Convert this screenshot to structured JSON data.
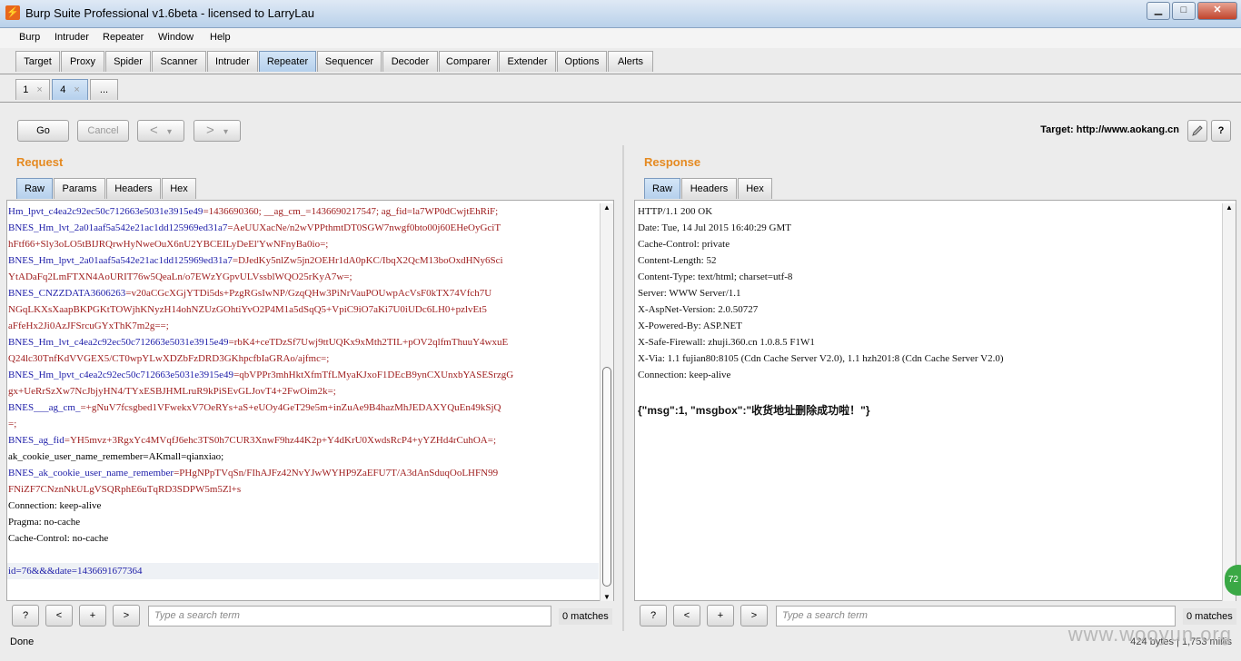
{
  "window": {
    "title": "Burp Suite Professional v1.6beta - licensed to LarryLau",
    "app_icon": "burp-icon",
    "minimize": "▁",
    "maximize": "□",
    "close": "✕"
  },
  "menu": [
    "Burp",
    "Intruder",
    "Repeater",
    "Window",
    "Help"
  ],
  "tabs": [
    "Target",
    "Proxy",
    "Spider",
    "Scanner",
    "Intruder",
    "Repeater",
    "Sequencer",
    "Decoder",
    "Comparer",
    "Extender",
    "Options",
    "Alerts"
  ],
  "active_tab": "Repeater",
  "repeater_tabs": [
    {
      "label": "1",
      "close": "×"
    },
    {
      "label": "4",
      "close": "×"
    },
    {
      "label": "..."
    }
  ],
  "toolbar": {
    "go": "Go",
    "cancel": "Cancel",
    "back": "<",
    "back_menu": "▾",
    "forward": ">",
    "forward_menu": "▾",
    "target": "Target: http://www.aokang.cn",
    "edit_icon": "pencil-icon",
    "help": "?"
  },
  "request": {
    "title": "Request",
    "tabs": [
      "Raw",
      "Params",
      "Headers",
      "Hex"
    ],
    "lines": [
      {
        "k": "Hm_lpvt_c4ea2c92ec50c712663e5031e3915e49",
        "v": "=1436690360; __ag_cm_=1436690217547; ag_fid=la7WP0dCwjtEhRiF;"
      },
      {
        "k": "BNES_Hm_lvt_2a01aaf5a542e21ac1dd125969ed31a7",
        "v": "=AeUUXacNe/n2wVPPthmtDT0SGW7nwgf0bto00j60EHeOyGciT"
      },
      {
        "k": "",
        "v": "hFtf66+Sly3oLO5tBIJRQrwHyNweOuX6nU2YBCEILyDeEl'YwNFnyBa0io=;"
      },
      {
        "k": "BNES_Hm_lpvt_2a01aaf5a542e21ac1dd125969ed31a7",
        "v": "=DJedKy5nlZw5jn2OEHr1dA0pKC/IbqX2QcM13boOxdHNy6Sci"
      },
      {
        "k": "",
        "v": "YtADaFq2LmFTXN4AoURIT76w5QeaLn/o7EWzYGpvULVssblWQO25rKyA7w=;"
      },
      {
        "k": "BNES_CNZZDATA3606263",
        "v": "=v20aCGcXGjYTDi5ds+PzgRGsIwNP/GzqQHw3PiNrVauPOUwpAcVsF0kTX74Vfch7U"
      },
      {
        "k": "",
        "v": "NGqLKXsXaapBKPGKtTOWjhKNyzH14ohNZUzGOhtiYvO2P4M1a5dSqQ5+VpiC9iO7aKi7U0iUDc6LH0+pzlvEt5"
      },
      {
        "k": "",
        "v": "aFfeHx2Ji0AzJFSrcuGYxThK7m2g==;"
      },
      {
        "k": "BNES_Hm_lvt_c4ea2c92ec50c712663e5031e3915e49",
        "v": "=rbK4+ceTDzSf7Uwj9ttUQKx9xMth2TIL+pOV2qlfmThuuY4wxuE"
      },
      {
        "k": "",
        "v": "Q24lc30TnfKdVVGEX5/CT0wpYLwXDZbFzDRD3GKhpcfbIaGRAo/ajfmc=;"
      },
      {
        "k": "BNES_Hm_lpvt_c4ea2c92ec50c712663e5031e3915e49",
        "v": "=qbVPPr3mhHktXfmTfLMyaKJxoF1DEcB9ynCXUnxbYASESrzgG"
      },
      {
        "k": "",
        "v": "gx+UeRrSzXw7NcJbjyHN4/TYxESBJHMLruR9kPiSEvGLJovT4+2FwOim2k=;"
      },
      {
        "k": "BNES___ag_cm_",
        "v": "=+gNuV7fcsgbed1VFwekxV7OeRYs+aS+eUOy4GeT29e5m+inZuAe9B4hazMhJEDAXYQuEn49kSjQ"
      },
      {
        "k": "",
        "v": "=;"
      },
      {
        "k": "BNES_ag_fid",
        "v": "=YH5mvz+3RgxYc4MVqfJ6ehc3TS0h7CUR3XnwF9hz44K2p+Y4dKrU0XwdsRcP4+yYZHd4rCuhOA=;"
      },
      {
        "k": "",
        "v": "ak_cookie_user_name_remember=AKmall=qianxiao;"
      },
      {
        "k": "BNES_ak_cookie_user_name_remember",
        "v": "=PHgNPpTVqSn/FIhAJFz42NvYJwWYHP9ZaEFU7T/A3dAnSduqOoLHFN99"
      },
      {
        "k": "",
        "v": "FNiZF7CNznNkULgVSQRphE6uTqRD3SDPW5m5Zl+s"
      },
      {
        "k": "",
        "v": "Connection: keep-alive"
      },
      {
        "k": "",
        "v": "Pragma: no-cache"
      },
      {
        "k": "",
        "v": "Cache-Control: no-cache"
      },
      {
        "k": "",
        "v": ""
      },
      {
        "k": "",
        "v": "id=76&&&date=1436691677364"
      }
    ],
    "help": "?",
    "prev": "<",
    "add": "+",
    "next": ">",
    "search_placeholder": "Type a search term",
    "matches": "0 matches",
    "up": "▲",
    "down": "▼"
  },
  "response": {
    "title": "Response",
    "tabs": [
      "Raw",
      "Headers",
      "Hex"
    ],
    "lines": [
      "HTTP/1.1 200 OK",
      "Date: Tue, 14 Jul 2015 16:40:29 GMT",
      "Cache-Control: private",
      "Content-Length: 52",
      "Content-Type: text/html; charset=utf-8",
      "Server: WWW Server/1.1",
      "X-AspNet-Version: 2.0.50727",
      "X-Powered-By: ASP.NET",
      "X-Safe-Firewall: zhuji.360.cn 1.0.8.5 F1W1",
      "X-Via: 1.1 fujian80:8105 (Cdn Cache Server V2.0), 1.1 hzh201:8 (Cdn Cache Server V2.0)",
      "Connection: keep-alive"
    ],
    "body": "{\"msg\":1, \"msgbox\":\"收货地址删除成功啦！\"}",
    "help": "?",
    "prev": "<",
    "add": "+",
    "next": ">",
    "search_placeholder": "Type a search term",
    "matches": "0 matches",
    "up": "▲"
  },
  "status": {
    "text": "Done",
    "bytes": "424 bytes | 1,753 millis"
  },
  "watermark": "www.wooyun.org",
  "badge": "72"
}
